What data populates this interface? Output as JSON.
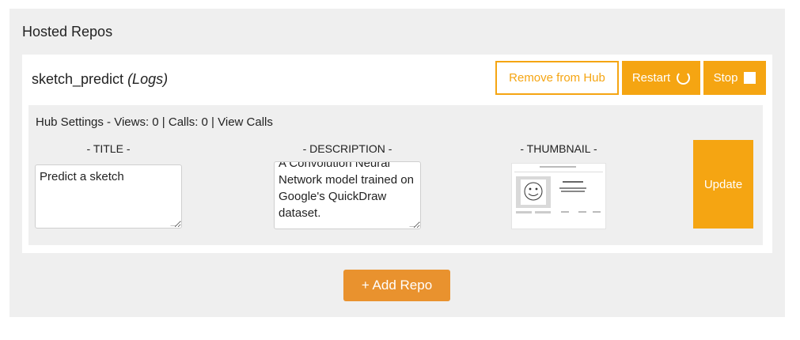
{
  "section": {
    "title": "Hosted Repos"
  },
  "repo": {
    "name": "sketch_predict",
    "logs_label": "(Logs)",
    "buttons": {
      "remove_label": "Remove from Hub",
      "restart_label": "Restart",
      "stop_label": "Stop",
      "restart_icon": "refresh-icon",
      "stop_icon": "stop-square-icon"
    },
    "hub_settings": {
      "prefix": "Hub Settings - Views: ",
      "views": "0",
      "calls_prefix": " | Calls: ",
      "calls": "0",
      "separator": " | ",
      "view_calls_label": "View Calls",
      "title_label": "- TITLE -",
      "description_label": "- DESCRIPTION -",
      "thumbnail_label": "- THUMBNAIL -",
      "title_value": "Predict a sketch",
      "description_value": "A Convolution Neural Network model trained on Google's QuickDraw dataset.",
      "update_label": "Update"
    }
  },
  "add_repo_label": "+ Add Repo",
  "colors": {
    "accent": "#f5a512",
    "add_button": "#e9922e",
    "panel_bg": "#efefef"
  }
}
